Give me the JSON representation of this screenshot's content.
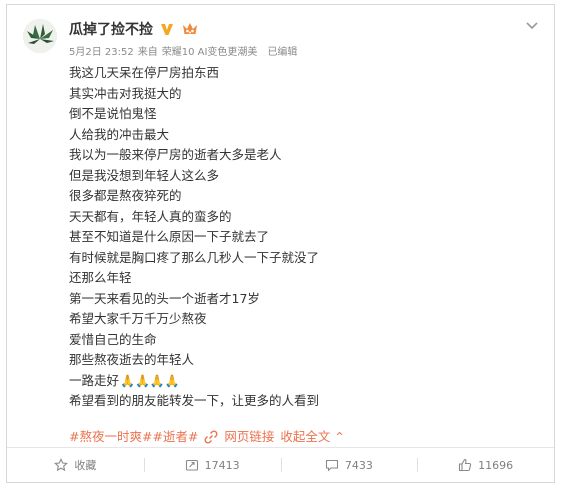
{
  "post": {
    "username": "瓜掉了捡不捡",
    "meta": {
      "date": "5月2日 23:52",
      "source_prefix": "来自",
      "source": "荣耀10 AI变色更潮美",
      "edited": "已编辑"
    },
    "lines": [
      "我这几天呆在停尸房拍东西",
      "其实冲击对我挺大的",
      "倒不是说怕鬼怪",
      "人给我的冲击最大",
      "我以为一般来停尸房的逝者大多是老人",
      "但是我没想到年轻人这么多",
      "很多都是熬夜猝死的",
      "天天都有，年轻人真的蛮多的",
      "甚至不知道是什么原因一下子就去了",
      "有时候就是胸口疼了那么几秒人一下子就没了",
      "还那么年轻",
      "第一天来看见的头一个逝者才17岁",
      "希望大家千万千万少熬夜",
      "爱惜自己的生命",
      "那些熬夜逝去的年轻人",
      "一路走好",
      "希望看到的朋友能转发一下，让更多的人看到"
    ],
    "pray_emojis": "🙏🙏🙏🙏",
    "hashtags": [
      "#熬夜一时爽#",
      "#逝者#"
    ],
    "web_link_label": "网页链接",
    "collapse_label": "收起全文 ⌃"
  },
  "toolbar": {
    "favorite_label": "收藏",
    "repost_count": "17413",
    "comment_count": "7433",
    "like_count": "11696"
  },
  "icons": {
    "verified": "verified-v-icon",
    "member": "member-crown-icon",
    "chevron": "chevron-down-icon",
    "star": "star-icon",
    "repost": "repost-icon",
    "comment": "comment-icon",
    "like": "thumbs-up-icon",
    "link": "link-icon"
  },
  "colors": {
    "accent": "#eb7350",
    "verified_gold": "#f5a623",
    "text": "#333333",
    "muted": "#8a8a8a"
  }
}
